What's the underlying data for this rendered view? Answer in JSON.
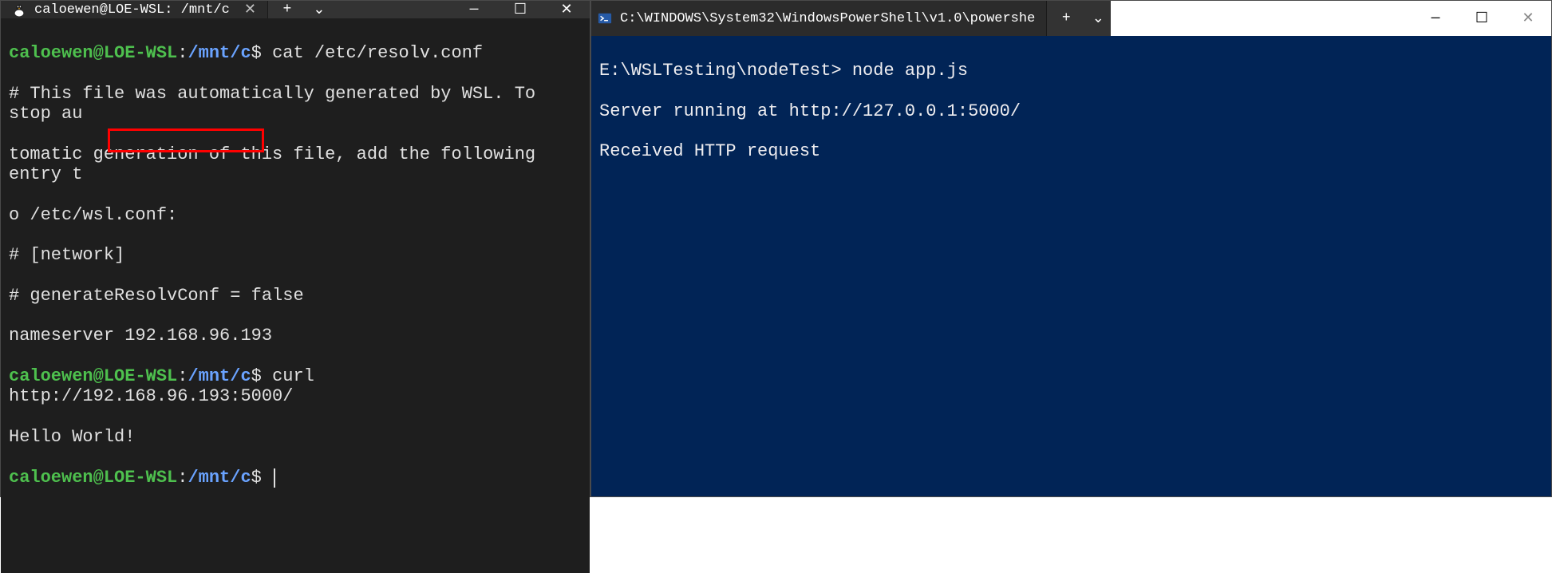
{
  "leftWindow": {
    "tab": {
      "title": "caloewen@LOE-WSL: /mnt/c",
      "iconName": "tux-icon"
    },
    "terminal": {
      "prompt": {
        "user": "caloewen",
        "at": "@",
        "host": "LOE-WSL",
        "colon": ":",
        "path": "/mnt/c",
        "dollar": "$"
      },
      "line1_cmd": " cat /etc/resolv.conf",
      "line2": "# This file was automatically generated by WSL. To stop au",
      "line3": "tomatic generation of this file, add the following entry t",
      "line4": "o /etc/wsl.conf:",
      "line5": "# [network]",
      "line6": "# generateResolvConf = false",
      "line7": "nameserver 192.168.96.193",
      "line8_cmd": " curl http://192.168.96.193:5000/",
      "line9": "Hello World!",
      "highlight_ip": "192.168.96.193"
    }
  },
  "rightWindow": {
    "tab": {
      "title": "C:\\WINDOWS\\System32\\WindowsPowerShell\\v1.0\\powershe",
      "iconName": "powershell-icon"
    },
    "terminal": {
      "prompt": "E:\\WSLTesting\\nodeTest>",
      "cmd": " node app.js",
      "out1": "Server running at http://127.0.0.1:5000/",
      "out2": "Received HTTP request"
    }
  },
  "controls": {
    "newTab": "+",
    "dropdown": "⌄",
    "minimize": "—",
    "maximize": "☐",
    "close": "✕"
  }
}
